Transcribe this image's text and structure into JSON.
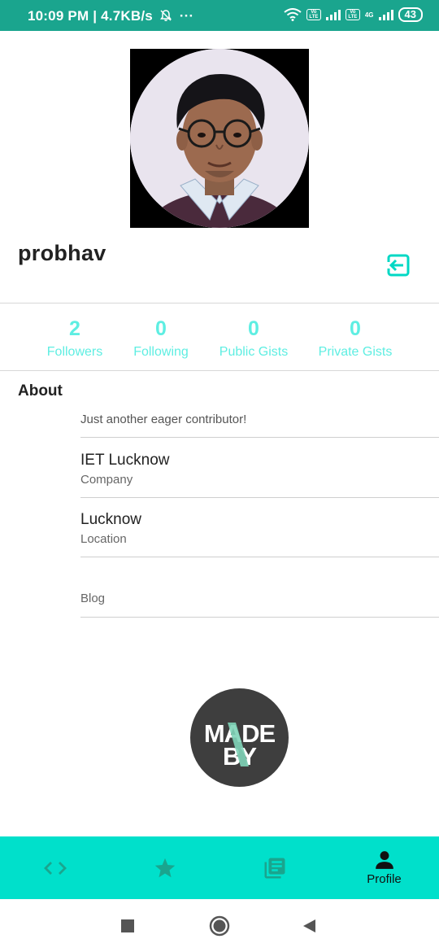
{
  "status_bar": {
    "time": "10:09 PM",
    "speed": "4.7KB/s",
    "more": "···",
    "volte1": "Vo LTE",
    "volte2": "Vo LTE",
    "network": "4G",
    "battery": "43"
  },
  "profile": {
    "username": "probhav"
  },
  "stats": [
    {
      "value": "2",
      "label": "Followers"
    },
    {
      "value": "0",
      "label": "Following"
    },
    {
      "value": "0",
      "label": "Public Gists"
    },
    {
      "value": "0",
      "label": "Private Gists"
    }
  ],
  "about": {
    "title": "About",
    "bio": "Just another eager contributor!",
    "company": {
      "value": "IET Lucknow",
      "label": "Company"
    },
    "location": {
      "value": "Lucknow",
      "label": "Location"
    },
    "blog": {
      "value": "",
      "label": "Blog"
    }
  },
  "logo": {
    "line1": "MADE",
    "line2": "BY"
  },
  "bottom_nav": {
    "items": [
      {
        "icon": "code-icon",
        "label": ""
      },
      {
        "icon": "star-icon",
        "label": ""
      },
      {
        "icon": "library-icon",
        "label": ""
      },
      {
        "icon": "person-icon",
        "label": "Profile"
      }
    ]
  },
  "colors": {
    "status_bar": "#1aa58e",
    "accent": "#00e0cb",
    "stat_text": "#5eeee2",
    "icon_teal": "#1aa58e"
  }
}
